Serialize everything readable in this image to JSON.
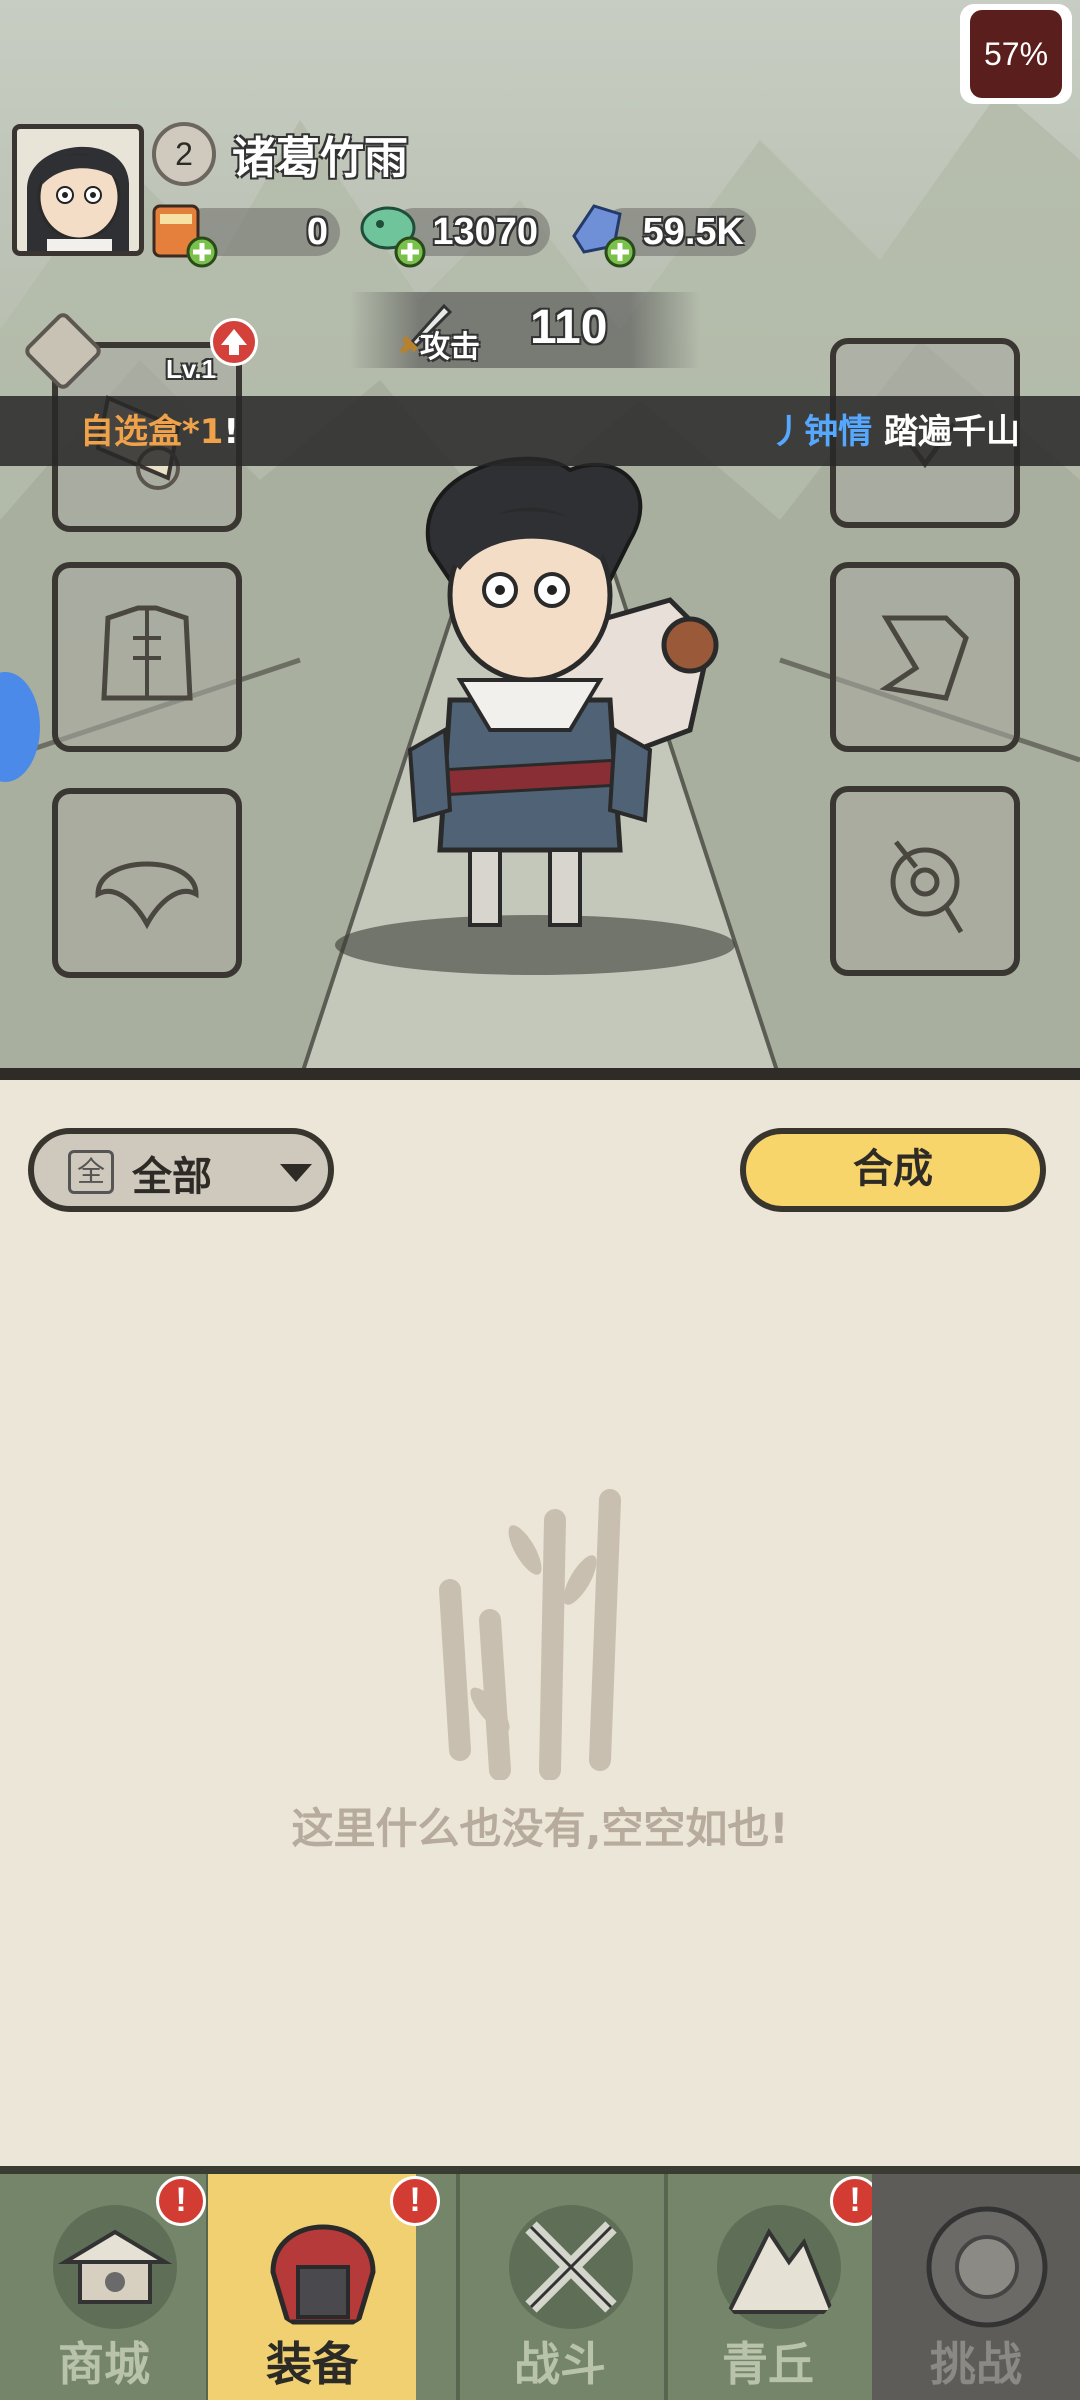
{
  "status": {
    "battery": "57%"
  },
  "player": {
    "level": "2",
    "name": "诸葛竹雨"
  },
  "resources": [
    {
      "name": "scroll",
      "value": "0"
    },
    {
      "name": "jade",
      "value": "13070"
    },
    {
      "name": "crystal",
      "value": "59.5K"
    }
  ],
  "stats": {
    "attack_label": "攻击",
    "attack_value": "110"
  },
  "marquee": {
    "left_prefix": "自选盒*1",
    "left_suffix": "!",
    "right_name": "丿钟情",
    "right_text": "踏遍千山"
  },
  "equipment": {
    "weapon_level": "Lv.1"
  },
  "filter": {
    "icon_text": "全",
    "label": "全部"
  },
  "compose_button": "合成",
  "empty_message": "这里什么也没有,空空如也!",
  "nav": [
    {
      "label": "商城",
      "alert": "!"
    },
    {
      "label": "装备",
      "alert": "!"
    },
    {
      "label": "战斗"
    },
    {
      "label": "青丘",
      "alert": "!"
    },
    {
      "label": "挑战"
    }
  ]
}
